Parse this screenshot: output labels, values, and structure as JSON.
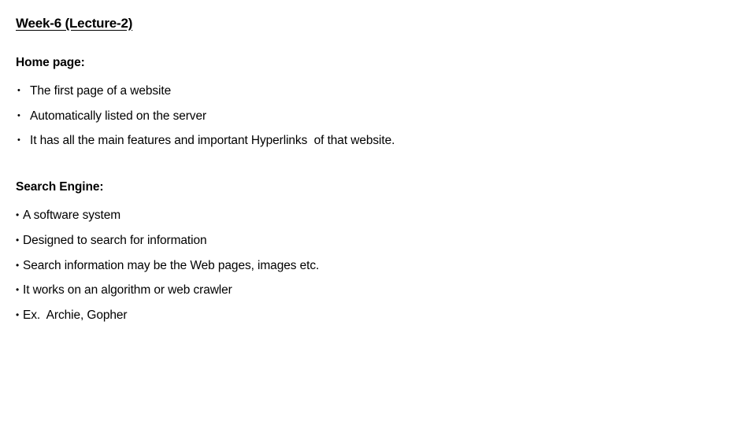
{
  "slide": {
    "title": "Week-6 (Lecture-2)",
    "background_color": "#FFFFFF",
    "text_color": "#000000",
    "sections": [
      {
        "heading": "Home page:",
        "bullet_glyph": "•",
        "bullets": [
          "The first page of a website",
          "Automatically listed on the server",
          "It has all the main features and important Hyperlinks  of that website."
        ]
      },
      {
        "heading": "Search Engine:",
        "bullet_glyph": "•",
        "bullets": [
          "A software system",
          "Designed to search for information",
          "Search information may be the Web pages, images etc.",
          "It works on an algorithm or web crawler",
          "Ex.  Archie, Gopher"
        ]
      }
    ]
  }
}
